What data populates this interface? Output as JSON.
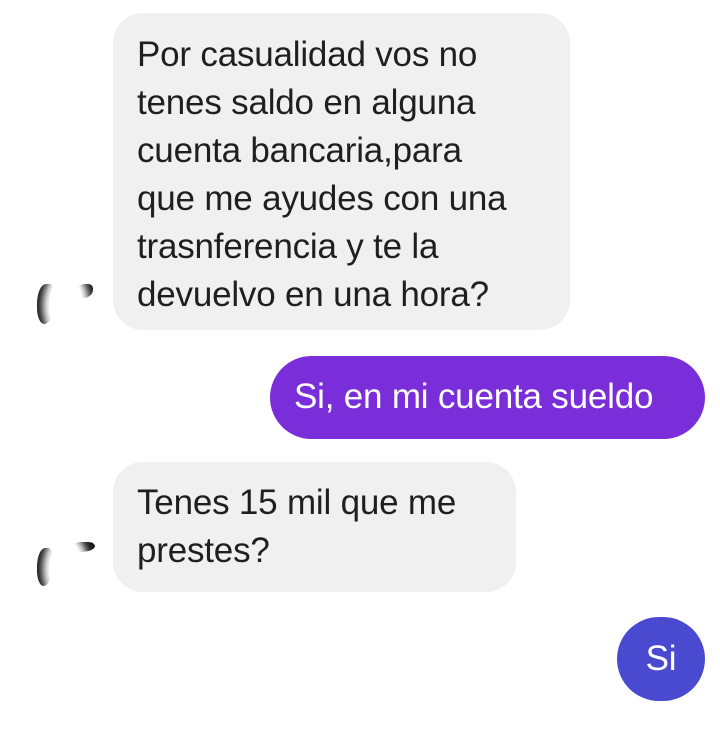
{
  "messages": [
    {
      "direction": "incoming",
      "text": "Por casualidad vos no\ntenes saldo en alguna\ncuenta bancaria,para\nque me ayudes con una\ntrasnferencia y te la\ndevuelvo en una hora?"
    },
    {
      "direction": "outgoing",
      "text": "Si, en mi cuenta sueldo"
    },
    {
      "direction": "incoming",
      "text": "Tenes 15 mil que me\nprestes?"
    },
    {
      "direction": "outgoing",
      "text": "Si"
    }
  ],
  "colors": {
    "incoming_bubble": "#f0f0f0",
    "incoming_text": "#1f1f1f",
    "outgoing_bubble_1": "#7a2ed9",
    "outgoing_bubble_2": "#4a4ad1",
    "outgoing_text": "#ffffff"
  }
}
